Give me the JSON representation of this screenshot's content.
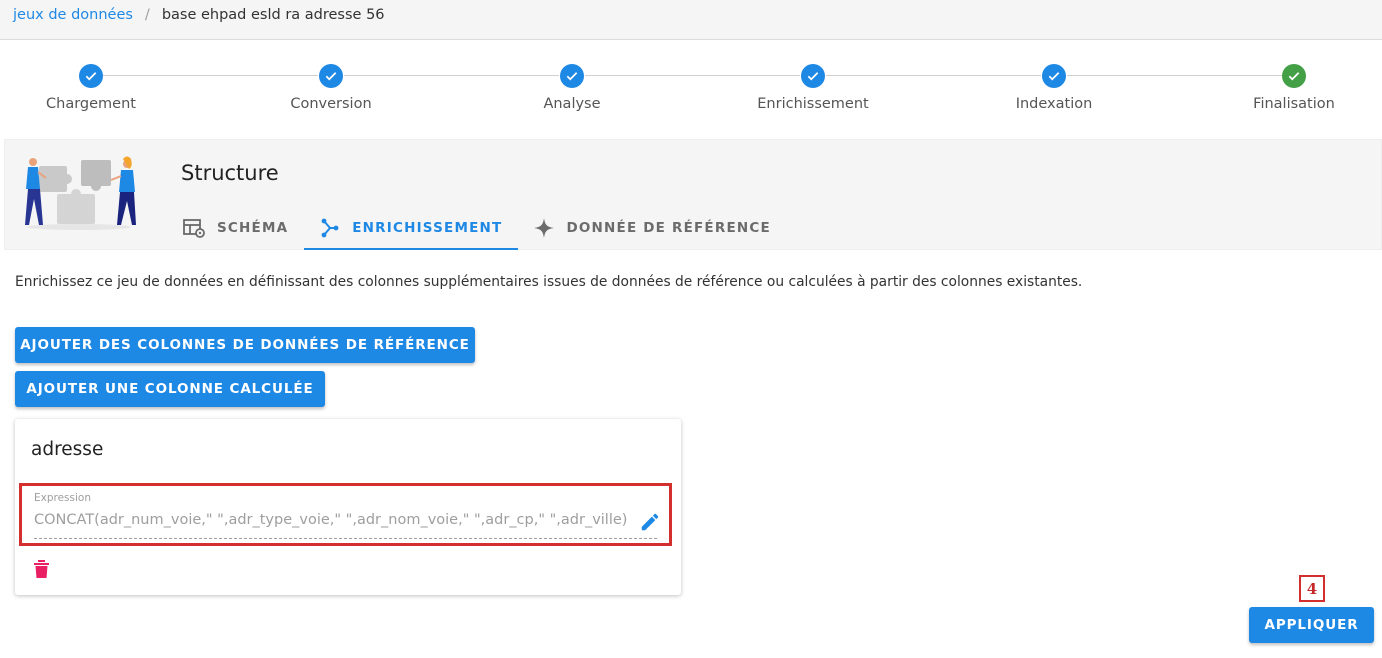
{
  "breadcrumb": {
    "root": "jeux de données",
    "separator": "/",
    "current": "base ehpad esld ra adresse 56"
  },
  "stepper": {
    "steps": [
      {
        "label": "Chargement",
        "status": "done"
      },
      {
        "label": "Conversion",
        "status": "done"
      },
      {
        "label": "Analyse",
        "status": "done"
      },
      {
        "label": "Enrichissement",
        "status": "done"
      },
      {
        "label": "Indexation",
        "status": "done"
      },
      {
        "label": "Finalisation",
        "status": "success"
      }
    ]
  },
  "structure": {
    "title": "Structure",
    "tabs": [
      {
        "label": "SCHÉMA",
        "icon": "table-cog-icon",
        "active": false
      },
      {
        "label": "ENRICHISSEMENT",
        "icon": "graph-branch-icon",
        "active": true
      },
      {
        "label": "DONNÉE DE RÉFÉRENCE",
        "icon": "sparkle-icon",
        "active": false
      }
    ]
  },
  "description": "Enrichissez ce jeu de données en définissant des colonnes supplémentaires issues de données de référence ou calculées à partir des colonnes existantes.",
  "actions": {
    "add_reference_label": "AJOUTER DES COLONNES DE DONNÉES DE RÉFÉRENCE",
    "add_computed_label": "AJOUTER UNE COLONNE CALCULÉE",
    "apply_label": "APPLIQUER"
  },
  "computed_column": {
    "name": "adresse",
    "expression_label": "Expression",
    "expression_value": "CONCAT(adr_num_voie,\" \",adr_type_voie,\" \",adr_nom_voie,\" \",adr_cp,\" \",adr_ville)"
  },
  "annotation": "4",
  "colors": {
    "primary": "#1e88e5",
    "success": "#43a047",
    "danger": "#e91e63",
    "highlight": "#d32f2f"
  }
}
